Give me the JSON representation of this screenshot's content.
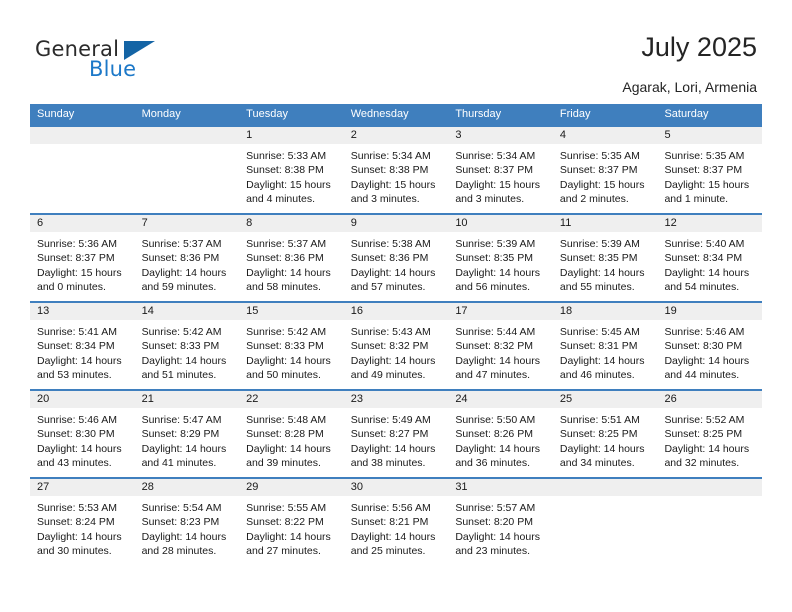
{
  "brand": {
    "name_dark": "General",
    "name_blue": "Blue",
    "triangle_color": "#1464a5",
    "blue_color": "#1c78c8"
  },
  "header": {
    "title": "July 2025",
    "subtitle": "Agarak, Lori, Armenia",
    "accent_color": "#3f7fbe",
    "daynum_bg": "#efefef"
  },
  "weekdays": [
    "Sunday",
    "Monday",
    "Tuesday",
    "Wednesday",
    "Thursday",
    "Friday",
    "Saturday"
  ],
  "labels": {
    "sunrise": "Sunrise:",
    "sunset": "Sunset:",
    "daylight": "Daylight:"
  },
  "weeks": [
    [
      {
        "day": "",
        "empty": true,
        "sunrise": "",
        "sunset": "",
        "daylight": ""
      },
      {
        "day": "",
        "empty": true,
        "sunrise": "",
        "sunset": "",
        "daylight": ""
      },
      {
        "day": "1",
        "sunrise": "Sunrise: 5:33 AM",
        "sunset": "Sunset: 8:38 PM",
        "daylight": "Daylight: 15 hours and 4 minutes."
      },
      {
        "day": "2",
        "sunrise": "Sunrise: 5:34 AM",
        "sunset": "Sunset: 8:38 PM",
        "daylight": "Daylight: 15 hours and 3 minutes."
      },
      {
        "day": "3",
        "sunrise": "Sunrise: 5:34 AM",
        "sunset": "Sunset: 8:37 PM",
        "daylight": "Daylight: 15 hours and 3 minutes."
      },
      {
        "day": "4",
        "sunrise": "Sunrise: 5:35 AM",
        "sunset": "Sunset: 8:37 PM",
        "daylight": "Daylight: 15 hours and 2 minutes."
      },
      {
        "day": "5",
        "sunrise": "Sunrise: 5:35 AM",
        "sunset": "Sunset: 8:37 PM",
        "daylight": "Daylight: 15 hours and 1 minute."
      }
    ],
    [
      {
        "day": "6",
        "sunrise": "Sunrise: 5:36 AM",
        "sunset": "Sunset: 8:37 PM",
        "daylight": "Daylight: 15 hours and 0 minutes."
      },
      {
        "day": "7",
        "sunrise": "Sunrise: 5:37 AM",
        "sunset": "Sunset: 8:36 PM",
        "daylight": "Daylight: 14 hours and 59 minutes."
      },
      {
        "day": "8",
        "sunrise": "Sunrise: 5:37 AM",
        "sunset": "Sunset: 8:36 PM",
        "daylight": "Daylight: 14 hours and 58 minutes."
      },
      {
        "day": "9",
        "sunrise": "Sunrise: 5:38 AM",
        "sunset": "Sunset: 8:36 PM",
        "daylight": "Daylight: 14 hours and 57 minutes."
      },
      {
        "day": "10",
        "sunrise": "Sunrise: 5:39 AM",
        "sunset": "Sunset: 8:35 PM",
        "daylight": "Daylight: 14 hours and 56 minutes."
      },
      {
        "day": "11",
        "sunrise": "Sunrise: 5:39 AM",
        "sunset": "Sunset: 8:35 PM",
        "daylight": "Daylight: 14 hours and 55 minutes."
      },
      {
        "day": "12",
        "sunrise": "Sunrise: 5:40 AM",
        "sunset": "Sunset: 8:34 PM",
        "daylight": "Daylight: 14 hours and 54 minutes."
      }
    ],
    [
      {
        "day": "13",
        "sunrise": "Sunrise: 5:41 AM",
        "sunset": "Sunset: 8:34 PM",
        "daylight": "Daylight: 14 hours and 53 minutes."
      },
      {
        "day": "14",
        "sunrise": "Sunrise: 5:42 AM",
        "sunset": "Sunset: 8:33 PM",
        "daylight": "Daylight: 14 hours and 51 minutes."
      },
      {
        "day": "15",
        "sunrise": "Sunrise: 5:42 AM",
        "sunset": "Sunset: 8:33 PM",
        "daylight": "Daylight: 14 hours and 50 minutes."
      },
      {
        "day": "16",
        "sunrise": "Sunrise: 5:43 AM",
        "sunset": "Sunset: 8:32 PM",
        "daylight": "Daylight: 14 hours and 49 minutes."
      },
      {
        "day": "17",
        "sunrise": "Sunrise: 5:44 AM",
        "sunset": "Sunset: 8:32 PM",
        "daylight": "Daylight: 14 hours and 47 minutes."
      },
      {
        "day": "18",
        "sunrise": "Sunrise: 5:45 AM",
        "sunset": "Sunset: 8:31 PM",
        "daylight": "Daylight: 14 hours and 46 minutes."
      },
      {
        "day": "19",
        "sunrise": "Sunrise: 5:46 AM",
        "sunset": "Sunset: 8:30 PM",
        "daylight": "Daylight: 14 hours and 44 minutes."
      }
    ],
    [
      {
        "day": "20",
        "sunrise": "Sunrise: 5:46 AM",
        "sunset": "Sunset: 8:30 PM",
        "daylight": "Daylight: 14 hours and 43 minutes."
      },
      {
        "day": "21",
        "sunrise": "Sunrise: 5:47 AM",
        "sunset": "Sunset: 8:29 PM",
        "daylight": "Daylight: 14 hours and 41 minutes."
      },
      {
        "day": "22",
        "sunrise": "Sunrise: 5:48 AM",
        "sunset": "Sunset: 8:28 PM",
        "daylight": "Daylight: 14 hours and 39 minutes."
      },
      {
        "day": "23",
        "sunrise": "Sunrise: 5:49 AM",
        "sunset": "Sunset: 8:27 PM",
        "daylight": "Daylight: 14 hours and 38 minutes."
      },
      {
        "day": "24",
        "sunrise": "Sunrise: 5:50 AM",
        "sunset": "Sunset: 8:26 PM",
        "daylight": "Daylight: 14 hours and 36 minutes."
      },
      {
        "day": "25",
        "sunrise": "Sunrise: 5:51 AM",
        "sunset": "Sunset: 8:25 PM",
        "daylight": "Daylight: 14 hours and 34 minutes."
      },
      {
        "day": "26",
        "sunrise": "Sunrise: 5:52 AM",
        "sunset": "Sunset: 8:25 PM",
        "daylight": "Daylight: 14 hours and 32 minutes."
      }
    ],
    [
      {
        "day": "27",
        "sunrise": "Sunrise: 5:53 AM",
        "sunset": "Sunset: 8:24 PM",
        "daylight": "Daylight: 14 hours and 30 minutes."
      },
      {
        "day": "28",
        "sunrise": "Sunrise: 5:54 AM",
        "sunset": "Sunset: 8:23 PM",
        "daylight": "Daylight: 14 hours and 28 minutes."
      },
      {
        "day": "29",
        "sunrise": "Sunrise: 5:55 AM",
        "sunset": "Sunset: 8:22 PM",
        "daylight": "Daylight: 14 hours and 27 minutes."
      },
      {
        "day": "30",
        "sunrise": "Sunrise: 5:56 AM",
        "sunset": "Sunset: 8:21 PM",
        "daylight": "Daylight: 14 hours and 25 minutes."
      },
      {
        "day": "31",
        "sunrise": "Sunrise: 5:57 AM",
        "sunset": "Sunset: 8:20 PM",
        "daylight": "Daylight: 14 hours and 23 minutes."
      },
      {
        "day": "",
        "empty": true,
        "sunrise": "",
        "sunset": "",
        "daylight": ""
      },
      {
        "day": "",
        "empty": true,
        "sunrise": "",
        "sunset": "",
        "daylight": ""
      }
    ]
  ]
}
